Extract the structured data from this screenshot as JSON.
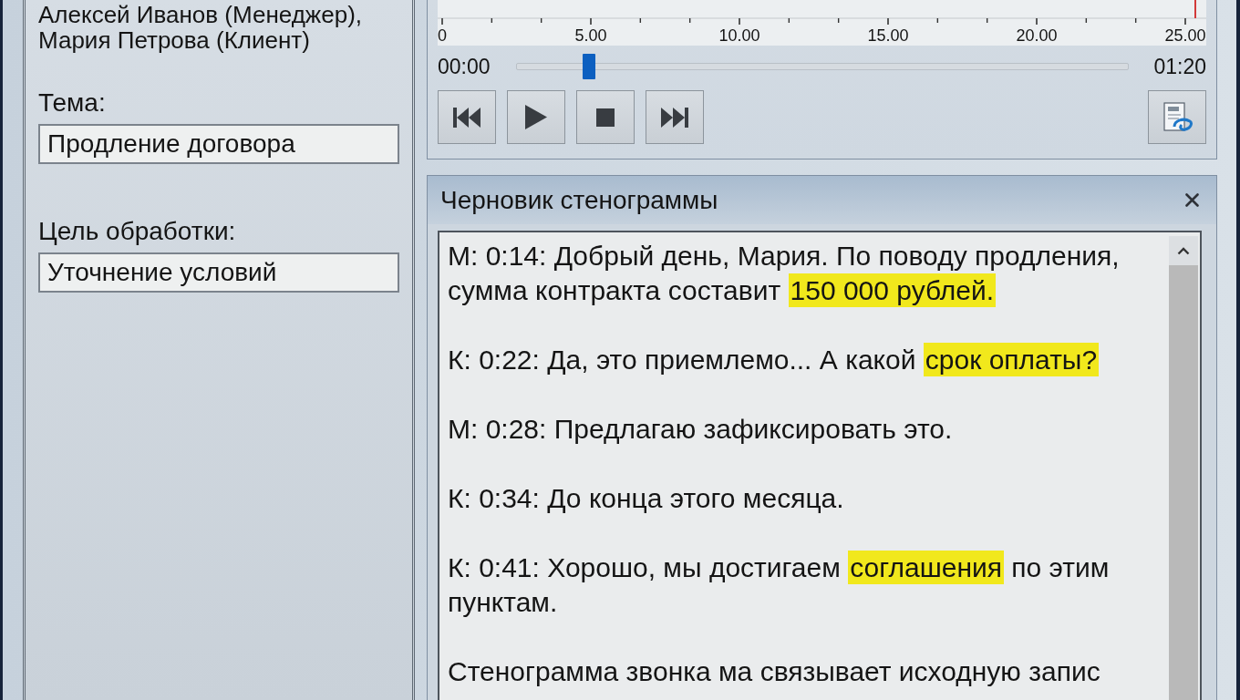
{
  "left_panel": {
    "participants": [
      "Алексей Иванов (Менеджер),",
      "Мария Петрова (Клиент)"
    ],
    "fields": [
      {
        "label": "Тема:",
        "value": "Продление договора"
      },
      {
        "label": "Цель обработки:",
        "value": "Уточнение условий"
      }
    ]
  },
  "player": {
    "ruler_labels": [
      "0",
      "5.00",
      "10.00",
      "15.00",
      "20.00",
      "25.00"
    ],
    "seek": {
      "start_time": "00:00",
      "level": 0.12,
      "end_time": "01:20"
    }
  },
  "transcript": {
    "title": "Черновик стенограммы",
    "entries": [
      {
        "segments": [
          {
            "text": "М: 0:14: Добрый день, Мария. По поводу продления, сумма контракта составит ",
            "highlighted": false
          },
          {
            "text": "150 000 рублей.",
            "highlighted": true
          }
        ]
      },
      {
        "segments": [
          {
            "text": "К: 0:22: Да, это приемлемо... А какой ",
            "highlighted": false
          },
          {
            "text": "срок оплаты?",
            "highlighted": true
          }
        ]
      },
      {
        "segments": [
          {
            "text": "М: 0:28: Предлагаю зафиксировать это.",
            "highlighted": false
          }
        ]
      },
      {
        "segments": [
          {
            "text": "К: 0:34: До конца этого месяца.",
            "highlighted": false
          }
        ]
      },
      {
        "segments": [
          {
            "text": "К: 0:41: Хорошо, мы достигаем ",
            "highlighted": false
          },
          {
            "text": "соглашения",
            "highlighted": true
          },
          {
            "text": " по этим пунктам.",
            "highlighted": false
          }
        ]
      },
      {
        "segments": [
          {
            "text": "Стенограмма звонка ма связывает исходную запис",
            "highlighted": false
          }
        ]
      }
    ]
  }
}
